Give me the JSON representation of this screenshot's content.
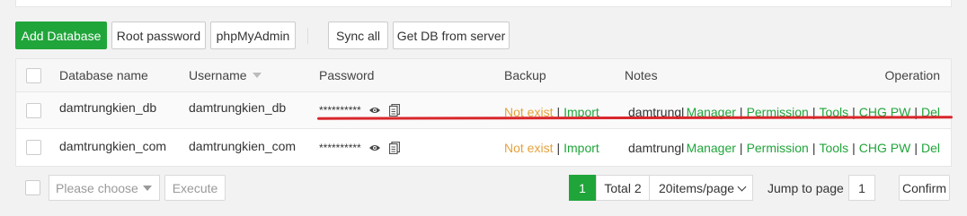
{
  "toolbar": {
    "add_database": "Add Database",
    "root_password": "Root password",
    "phpmyadmin": "phpMyAdmin",
    "sync_all": "Sync all",
    "get_db": "Get DB from server"
  },
  "table": {
    "headers": {
      "name": "Database name",
      "username": "Username",
      "password": "Password",
      "backup": "Backup",
      "notes": "Notes",
      "operation": "Operation"
    },
    "rows": [
      {
        "name": "damtrungkien_db",
        "username": "damtrungkien_db",
        "password": "**********",
        "backup_status": "Not exist",
        "backup_import": "Import",
        "notes": "damtrungl",
        "ops": [
          "Manager",
          "Permission",
          "Tools",
          "CHG PW",
          "Del"
        ]
      },
      {
        "name": "damtrungkien_com",
        "username": "damtrungkien_com",
        "password": "**********",
        "backup_status": "Not exist",
        "backup_import": "Import",
        "notes": "damtrungl",
        "ops": [
          "Manager",
          "Permission",
          "Tools",
          "CHG PW",
          "Del"
        ]
      }
    ]
  },
  "footer": {
    "batch_placeholder": "Please choose",
    "execute": "Execute",
    "current_page": "1",
    "total": "Total 2",
    "per_page": "20items/page",
    "jump_label": "Jump to page",
    "jump_value": "1",
    "confirm": "Confirm"
  },
  "colors": {
    "accent": "#20a53a",
    "warning": "#e6a23c",
    "highlight_line": "#d9262b"
  },
  "icons": [
    "eye-icon",
    "copy-icon",
    "chevron-down-icon",
    "sort-down-icon"
  ]
}
